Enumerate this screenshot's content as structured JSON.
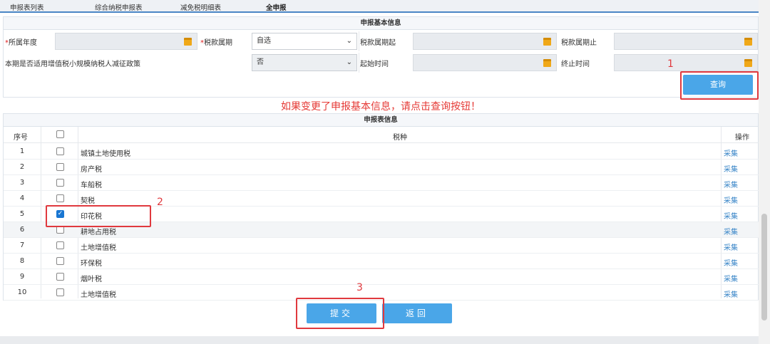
{
  "tabs": [
    "申报表列表",
    "综合纳税申报表",
    "减免税明细表",
    "全申报"
  ],
  "basic_info": {
    "title": "申报基本信息",
    "year_label": "所属年度",
    "period_label": "税款属期",
    "period_value": "自选",
    "period_start_label": "税款属期起",
    "period_end_label": "税款属期止",
    "policy_label": "本期是否适用增值税小规模纳税人减征政策",
    "policy_value": "否",
    "start_time_label": "起始时间",
    "end_time_label": "终止时间",
    "required_mark": "*"
  },
  "query_button": "查询",
  "hint": "如果变更了申报基本信息，请点击查询按钮！",
  "table": {
    "title": "申报表信息",
    "headers": [
      "序号",
      "税种",
      "操作"
    ],
    "rows": [
      {
        "no": "1",
        "name": "城镇土地使用税",
        "op": "采集",
        "checked": false
      },
      {
        "no": "2",
        "name": "房产税",
        "op": "采集",
        "checked": false
      },
      {
        "no": "3",
        "name": "车船税",
        "op": "采集",
        "checked": false
      },
      {
        "no": "4",
        "name": "契税",
        "op": "采集",
        "checked": false
      },
      {
        "no": "5",
        "name": "印花税",
        "op": "采集",
        "checked": true
      },
      {
        "no": "6",
        "name": "耕地占用税",
        "op": "采集",
        "checked": false
      },
      {
        "no": "7",
        "name": "土地增值税",
        "op": "采集",
        "checked": false
      },
      {
        "no": "8",
        "name": "环保税",
        "op": "采集",
        "checked": false
      },
      {
        "no": "9",
        "name": "烟叶税",
        "op": "采集",
        "checked": false
      },
      {
        "no": "10",
        "name": "土地增值税",
        "op": "采集",
        "checked": false
      }
    ]
  },
  "submit_button": "提交",
  "back_button": "返回",
  "annotations": [
    "1",
    "2",
    "3"
  ],
  "colors": {
    "primary": "#4aa6e8",
    "highlight": "#e0393e",
    "link": "#3a86c8"
  },
  "icons": [
    "calendar-icon",
    "chevron-down-icon",
    "check-icon"
  ]
}
